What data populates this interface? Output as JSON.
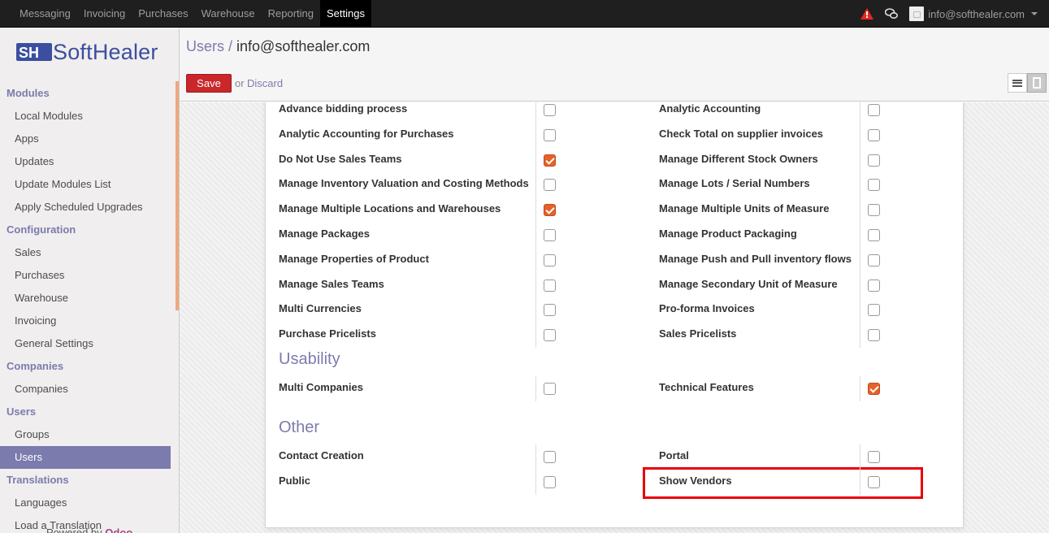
{
  "topbar": {
    "menu": [
      "Messaging",
      "Invoicing",
      "Purchases",
      "Warehouse",
      "Reporting",
      "Settings"
    ],
    "active": "Settings",
    "user": "info@softhealer.com",
    "icons": [
      "warning-icon",
      "chat-icon"
    ]
  },
  "sidebar": {
    "logo": "SoftHealer",
    "sections": [
      {
        "title": "Modules",
        "items": [
          "Local Modules",
          "Apps",
          "Updates",
          "Update Modules List",
          "Apply Scheduled Upgrades"
        ]
      },
      {
        "title": "Configuration",
        "items": [
          "Sales",
          "Purchases",
          "Warehouse",
          "Invoicing",
          "General Settings"
        ]
      },
      {
        "title": "Companies",
        "items": [
          "Companies"
        ]
      },
      {
        "title": "Users",
        "items": [
          "Groups",
          "Users"
        ]
      },
      {
        "title": "Translations",
        "items": [
          "Languages",
          "Load a Translation"
        ]
      }
    ],
    "active_item": "Users",
    "powered_by": "Powered by",
    "powered_brand": "Odoo"
  },
  "control_panel": {
    "breadcrumb_link": "Users",
    "breadcrumb_sep": " / ",
    "breadcrumb_current": "info@softhealer.com",
    "save_label": "Save",
    "or_label": "or",
    "discard_label": "Discard"
  },
  "form": {
    "rows": [
      {
        "left": "Advance bidding process",
        "left_checked": false,
        "right": "Analytic Accounting",
        "right_checked": false
      },
      {
        "left": "Analytic Accounting for Purchases",
        "left_checked": false,
        "right": "Check Total on supplier invoices",
        "right_checked": false
      },
      {
        "left": "Do Not Use Sales Teams",
        "left_checked": true,
        "right": "Manage Different Stock Owners",
        "right_checked": false
      },
      {
        "left": "Manage Inventory Valuation and Costing Methods",
        "left_checked": false,
        "right": "Manage Lots / Serial Numbers",
        "right_checked": false
      },
      {
        "left": "Manage Multiple Locations and Warehouses",
        "left_checked": true,
        "right": "Manage Multiple Units of Measure",
        "right_checked": false
      },
      {
        "left": "Manage Packages",
        "left_checked": false,
        "right": "Manage Product Packaging",
        "right_checked": false
      },
      {
        "left": "Manage Properties of Product",
        "left_checked": false,
        "right": "Manage Push and Pull inventory flows",
        "right_checked": false
      },
      {
        "left": "Manage Sales Teams",
        "left_checked": false,
        "right": "Manage Secondary Unit of Measure",
        "right_checked": false
      },
      {
        "left": "Multi Currencies",
        "left_checked": false,
        "right": "Pro-forma Invoices",
        "right_checked": false
      },
      {
        "left": "Purchase Pricelists",
        "left_checked": false,
        "right": "Sales Pricelists",
        "right_checked": false
      }
    ],
    "usability": {
      "title": "Usability",
      "rows": [
        {
          "left": "Multi Companies",
          "left_checked": false,
          "right": "Technical Features",
          "right_checked": true
        }
      ]
    },
    "other": {
      "title": "Other",
      "rows": [
        {
          "left": "Contact Creation",
          "left_checked": false,
          "right": "Portal",
          "right_checked": false
        },
        {
          "left": "Public",
          "left_checked": false,
          "right": "Show Vendors",
          "right_checked": false
        }
      ]
    },
    "highlight_color": "#e8000b",
    "accent_color": "#7c7bad",
    "checkbox_color": "#e5622a"
  }
}
